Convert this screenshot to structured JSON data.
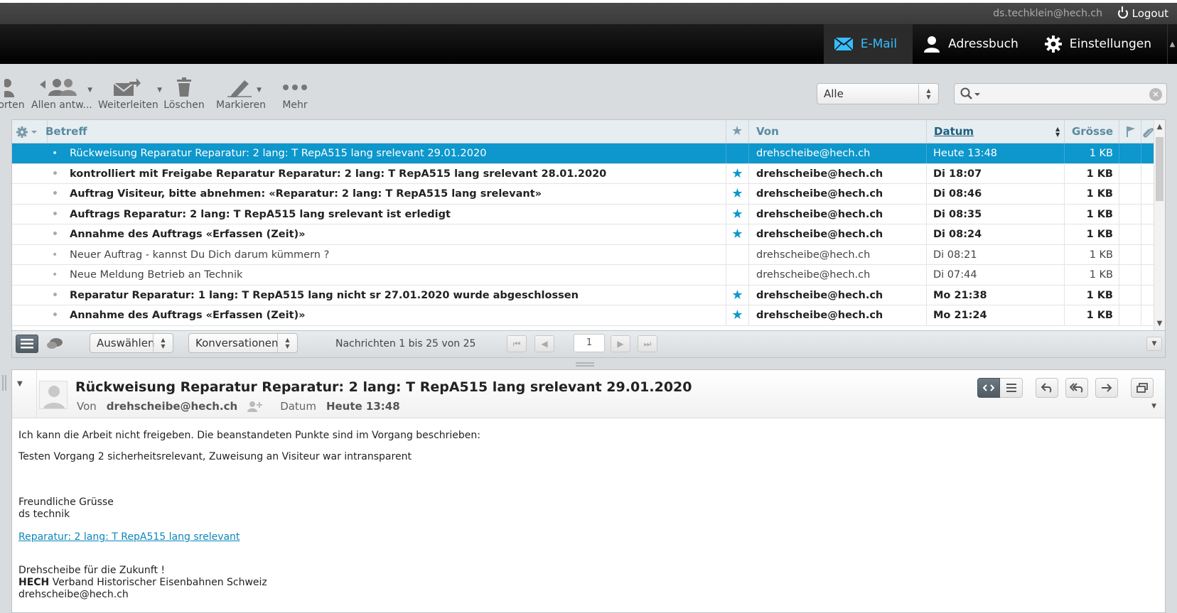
{
  "topbar": {
    "user": "ds.techklein@hech.ch",
    "logout": "Logout"
  },
  "nav": [
    {
      "label": "E-Mail",
      "icon": "mail-icon",
      "active": true
    },
    {
      "label": "Adressbuch",
      "icon": "person-icon",
      "active": false
    },
    {
      "label": "Einstellungen",
      "icon": "gear-icon",
      "active": false
    }
  ],
  "toolbar": {
    "reply": "orten",
    "reply_all": "Allen antw...",
    "forward": "Weiterleiten",
    "delete": "Löschen",
    "mark": "Markieren",
    "more": "Mehr"
  },
  "filter": {
    "selected": "Alle"
  },
  "search": {
    "placeholder": ""
  },
  "list": {
    "headers": {
      "subject": "Betreff",
      "from": "Von",
      "date": "Datum",
      "size": "Grösse"
    },
    "rows": [
      {
        "subject": "Rückweisung Reparatur Reparatur: 2 lang: T RepA515 lang srelevant 29.01.2020",
        "from": "drehscheibe@hech.ch",
        "date": "Heute 13:48",
        "size": "1 KB",
        "flagged": false,
        "state": "selected"
      },
      {
        "subject": "kontrolliert mit Freigabe Reparatur Reparatur: 2 lang: T RepA515 lang srelevant 28.01.2020",
        "from": "drehscheibe@hech.ch",
        "date": "Di 18:07",
        "size": "1 KB",
        "flagged": true,
        "state": "unread"
      },
      {
        "subject": "Auftrag Visiteur, bitte abnehmen: «Reparatur: 2 lang: T RepA515 lang srelevant»",
        "from": "drehscheibe@hech.ch",
        "date": "Di 08:46",
        "size": "1 KB",
        "flagged": true,
        "state": "unread"
      },
      {
        "subject": "Auftrags Reparatur: 2 lang: T RepA515 lang srelevant ist erledigt",
        "from": "drehscheibe@hech.ch",
        "date": "Di 08:35",
        "size": "1 KB",
        "flagged": true,
        "state": "unread"
      },
      {
        "subject": "Annahme des Auftrags «Erfassen (Zeit)»",
        "from": "drehscheibe@hech.ch",
        "date": "Di 08:24",
        "size": "1 KB",
        "flagged": true,
        "state": "unread"
      },
      {
        "subject": "Neuer Auftrag - kannst Du Dich darum kümmern ?",
        "from": "drehscheibe@hech.ch",
        "date": "Di 08:21",
        "size": "1 KB",
        "flagged": false,
        "state": "read"
      },
      {
        "subject": "Neue Meldung Betrieb an Technik",
        "from": "drehscheibe@hech.ch",
        "date": "Di 07:44",
        "size": "1 KB",
        "flagged": false,
        "state": "read"
      },
      {
        "subject": "Reparatur Reparatur: 1 lang: T RepA515 lang nicht sr 27.01.2020 wurde abgeschlossen",
        "from": "drehscheibe@hech.ch",
        "date": "Mo 21:38",
        "size": "1 KB",
        "flagged": true,
        "state": "unread"
      },
      {
        "subject": "Annahme des Auftrags «Erfassen (Zeit)»",
        "from": "drehscheibe@hech.ch",
        "date": "Mo 21:24",
        "size": "1 KB",
        "flagged": true,
        "state": "unread"
      }
    ]
  },
  "footer": {
    "select": "Auswählen",
    "threads": "Konversationen",
    "count": "Nachrichten 1 bis 25 von 25",
    "page": "1"
  },
  "preview": {
    "subject": "Rückweisung Reparatur Reparatur: 2 lang: T RepA515 lang srelevant 29.01.2020",
    "from_label": "Von",
    "from": "drehscheibe@hech.ch",
    "date_label": "Datum",
    "date": "Heute 13:48",
    "body": {
      "line1": "Ich kann die Arbeit nicht freigeben. Die beanstandeten Punkte sind im Vorgang beschrieben:",
      "line2": "Testen Vorgang 2 sicherheitsrelevant, Zuweisung an Visiteur war intransparent",
      "greeting": "Freundliche Grüsse",
      "signature": "ds technik",
      "link": "Reparatur: 2 lang: T RepA515 lang srelevant",
      "footer1": "Drehscheibe für die Zukunft !",
      "footer_org_bold": "HECH",
      "footer_org": " Verband Historischer Eisenbahnen Schweiz",
      "footer_mail": "drehscheibe@hech.ch"
    }
  },
  "colors": {
    "accent": "#0d97cc",
    "nav_active": "#37beff",
    "header_bg": "#000000"
  }
}
